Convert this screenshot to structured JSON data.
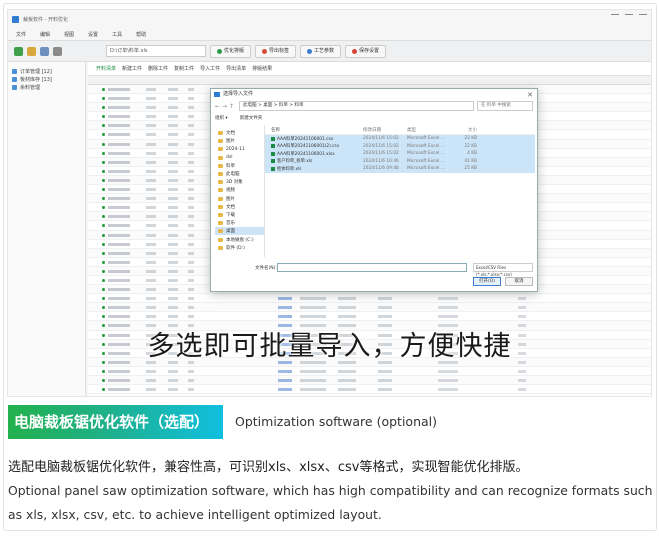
{
  "screenshot": {
    "window_title": "裁板软件 - 开料优化",
    "menu": [
      "文件",
      "编辑",
      "视图",
      "设置",
      "工具",
      "帮助"
    ],
    "toolbar": {
      "path": "D:\\订单\\料单.xls",
      "buttons": [
        "优化排版",
        "导出标签",
        "工艺参数",
        "保存设置"
      ]
    },
    "tree": [
      "订单管理 [12]",
      "板材库存 [13]",
      "余料管理"
    ],
    "subtabs": [
      "开料清单",
      "新建工件",
      "删除工件",
      "复制工件",
      "导入工件",
      "导出清单",
      "排版结果"
    ],
    "dialog": {
      "title": "选择导入文件",
      "path": "此电脑 > 桌面 > 料单 > 料单",
      "search": "在 料单 中搜索",
      "commands": [
        "组织 ▾",
        "新建文件夹"
      ],
      "nav": [
        "文档",
        "图片",
        "2024-11",
        "dsl",
        "料单",
        "此电脑",
        "3D 对象",
        "视频",
        "图片",
        "文档",
        "下载",
        "音乐",
        "桌面",
        "本地磁盘 (C:)",
        "软件 (D:)"
      ],
      "nav_selected_index": 12,
      "headers": [
        "名称",
        "修改日期",
        "类型",
        "大小"
      ],
      "files": [
        {
          "name": "AAA料单20241106001.csv",
          "date": "2024/11/6 15:02",
          "type": "Microsoft Excel ...",
          "size": "22 KB",
          "selected": true
        },
        {
          "name": "AAA料单20241106001(2).csv",
          "date": "2024/11/6 15:02",
          "type": "Microsoft Excel ...",
          "size": "22 KB",
          "selected": true
        },
        {
          "name": "AAA料单20241106001.xlsx",
          "date": "2024/11/6 15:02",
          "type": "Microsoft Excel ...",
          "size": "4 KB",
          "selected": true
        },
        {
          "name": "客户料单_拆单.xls",
          "date": "2024/11/6 10:46",
          "type": "Microsoft Excel ...",
          "size": "41 KB",
          "selected": true
        },
        {
          "name": "柜体料单.xls",
          "date": "2024/11/6 09:48",
          "type": "Microsoft Excel ...",
          "size": "25 KB",
          "selected": true
        }
      ],
      "filename_label": "文件名(N):",
      "filetype": "Excel/CSV Files (*.xls;*.xlsx;*.csv)",
      "open_label": "打开(O)",
      "cancel_label": "取消"
    },
    "overlay_caption": "多选即可批量导入，方便快捷"
  },
  "feature": {
    "badge": "电脑裁板锯优化软件（选配）",
    "badge_subtitle": "Optimization software (optional)",
    "description_cn": "选配电脑裁板锯优化软件，兼容性高，可识别xls、xlsx、csv等格式，实现智能优化排版。",
    "description_en": "Optional panel saw optimization software, which has high compatibility and can recognize formats such as xls, xlsx, csv, etc. to achieve intelligent optimized layout."
  }
}
